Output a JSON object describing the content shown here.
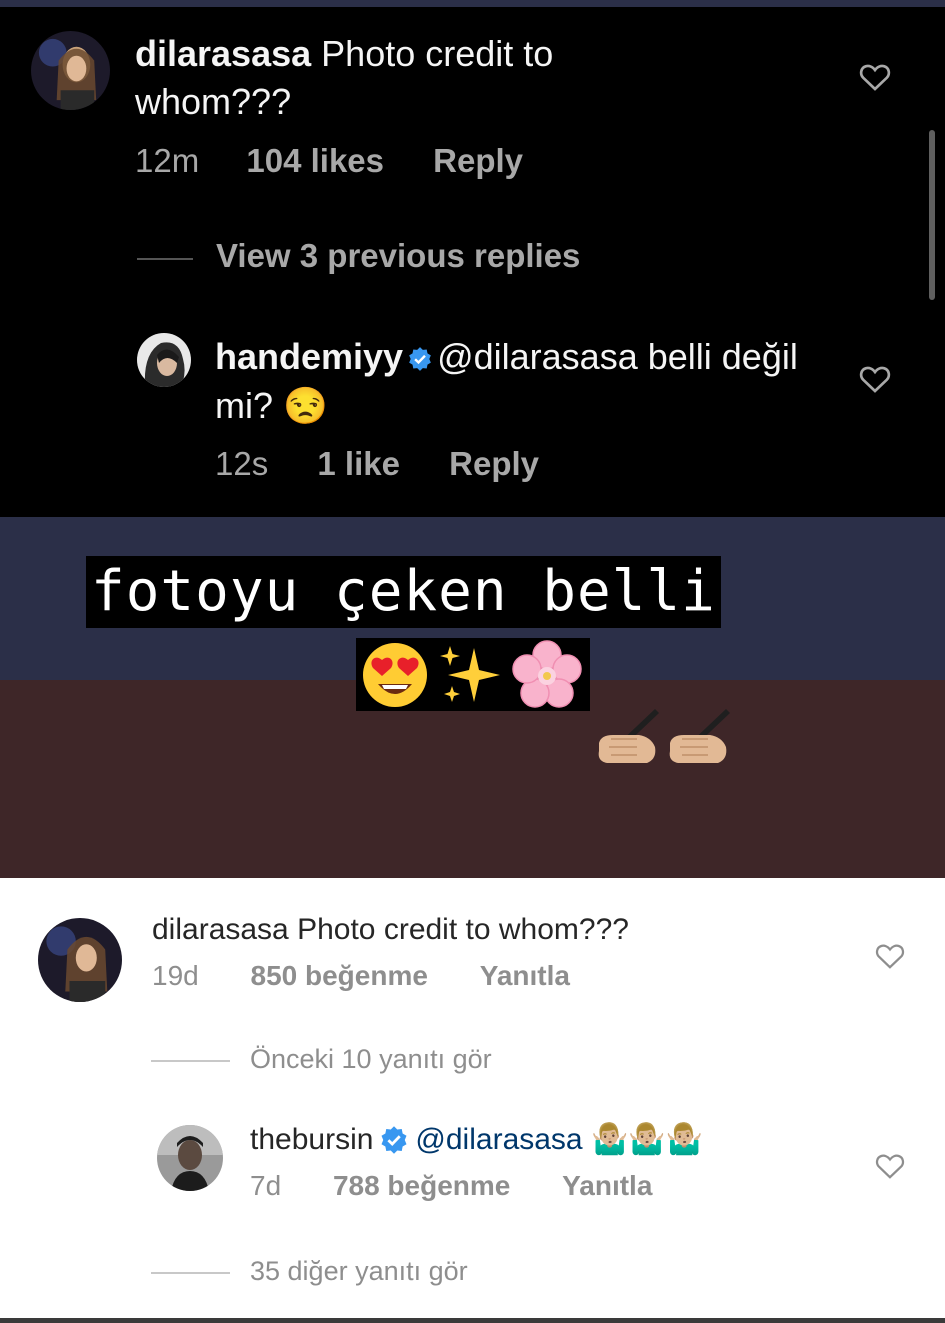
{
  "dark_comment": {
    "username": "dilarasasa",
    "text": "Photo credit to whom???",
    "time": "12m",
    "likes": "104 likes",
    "reply_label": "Reply"
  },
  "dark_view_replies": "View 3 previous replies",
  "dark_reply": {
    "username": "handemiyy",
    "mention": "@dilarasasa",
    "text": "belli değil mi?",
    "emoji": "😒",
    "time": "12s",
    "likes": "1 like",
    "reply_label": "Reply"
  },
  "story": {
    "caption": "fotoyu çeken belli",
    "emojis": [
      "😍",
      "✨",
      "🌸"
    ],
    "hand_emojis": [
      "✍🏼",
      "✍🏼"
    ],
    "banner_colors": [
      "#2b2f48",
      "#3e2628"
    ]
  },
  "light_comment": {
    "username": "dilarasasa",
    "text": "Photo credit to whom???",
    "time": "19d",
    "likes": "850 beğenme",
    "reply_label": "Yanıtla"
  },
  "light_view_replies": "Önceki 10 yanıtı gör",
  "light_reply": {
    "username": "thebursin",
    "mention": "@dilarasasa",
    "emojis": "🤷🏼‍♂️🤷🏼‍♂️🤷🏼‍♂️",
    "time": "7d",
    "likes": "788 beğenme",
    "reply_label": "Yanıtla"
  },
  "light_more_replies": "35 diğer yanıtı gör",
  "icons": {
    "heart": "heart-outline-icon",
    "verified": "verified-badge-icon"
  },
  "colors": {
    "verified_blue": "#3897f0",
    "mention_light": "#00376b"
  }
}
